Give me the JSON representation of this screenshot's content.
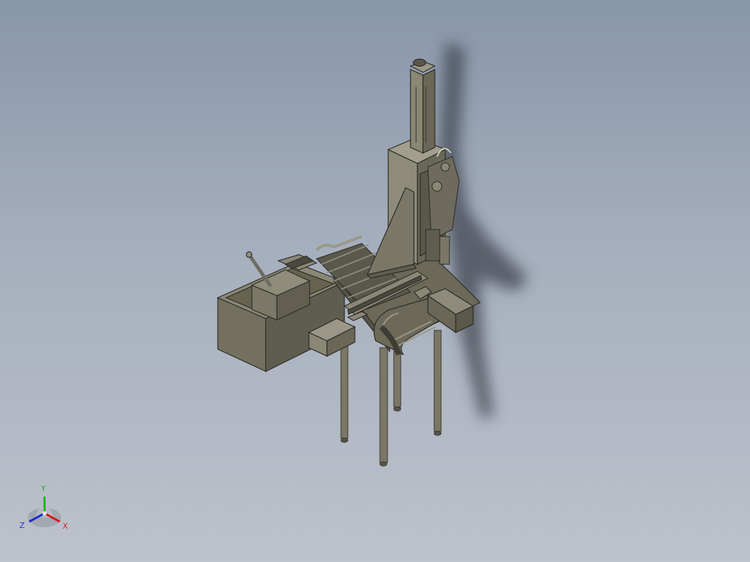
{
  "viewport": {
    "background_top": "#8896aa",
    "background_bottom": "#bdc2cb"
  },
  "model": {
    "body_color": "#73705f",
    "body_dark": "#55534a",
    "body_light": "#8e8b7a",
    "shadow_color": "#3a3f48"
  },
  "triad": {
    "x_label": "X",
    "y_label": "Y",
    "z_label": "Z",
    "x_color": "#d61a1a",
    "y_color": "#19b419",
    "z_color": "#1a2ed6"
  }
}
